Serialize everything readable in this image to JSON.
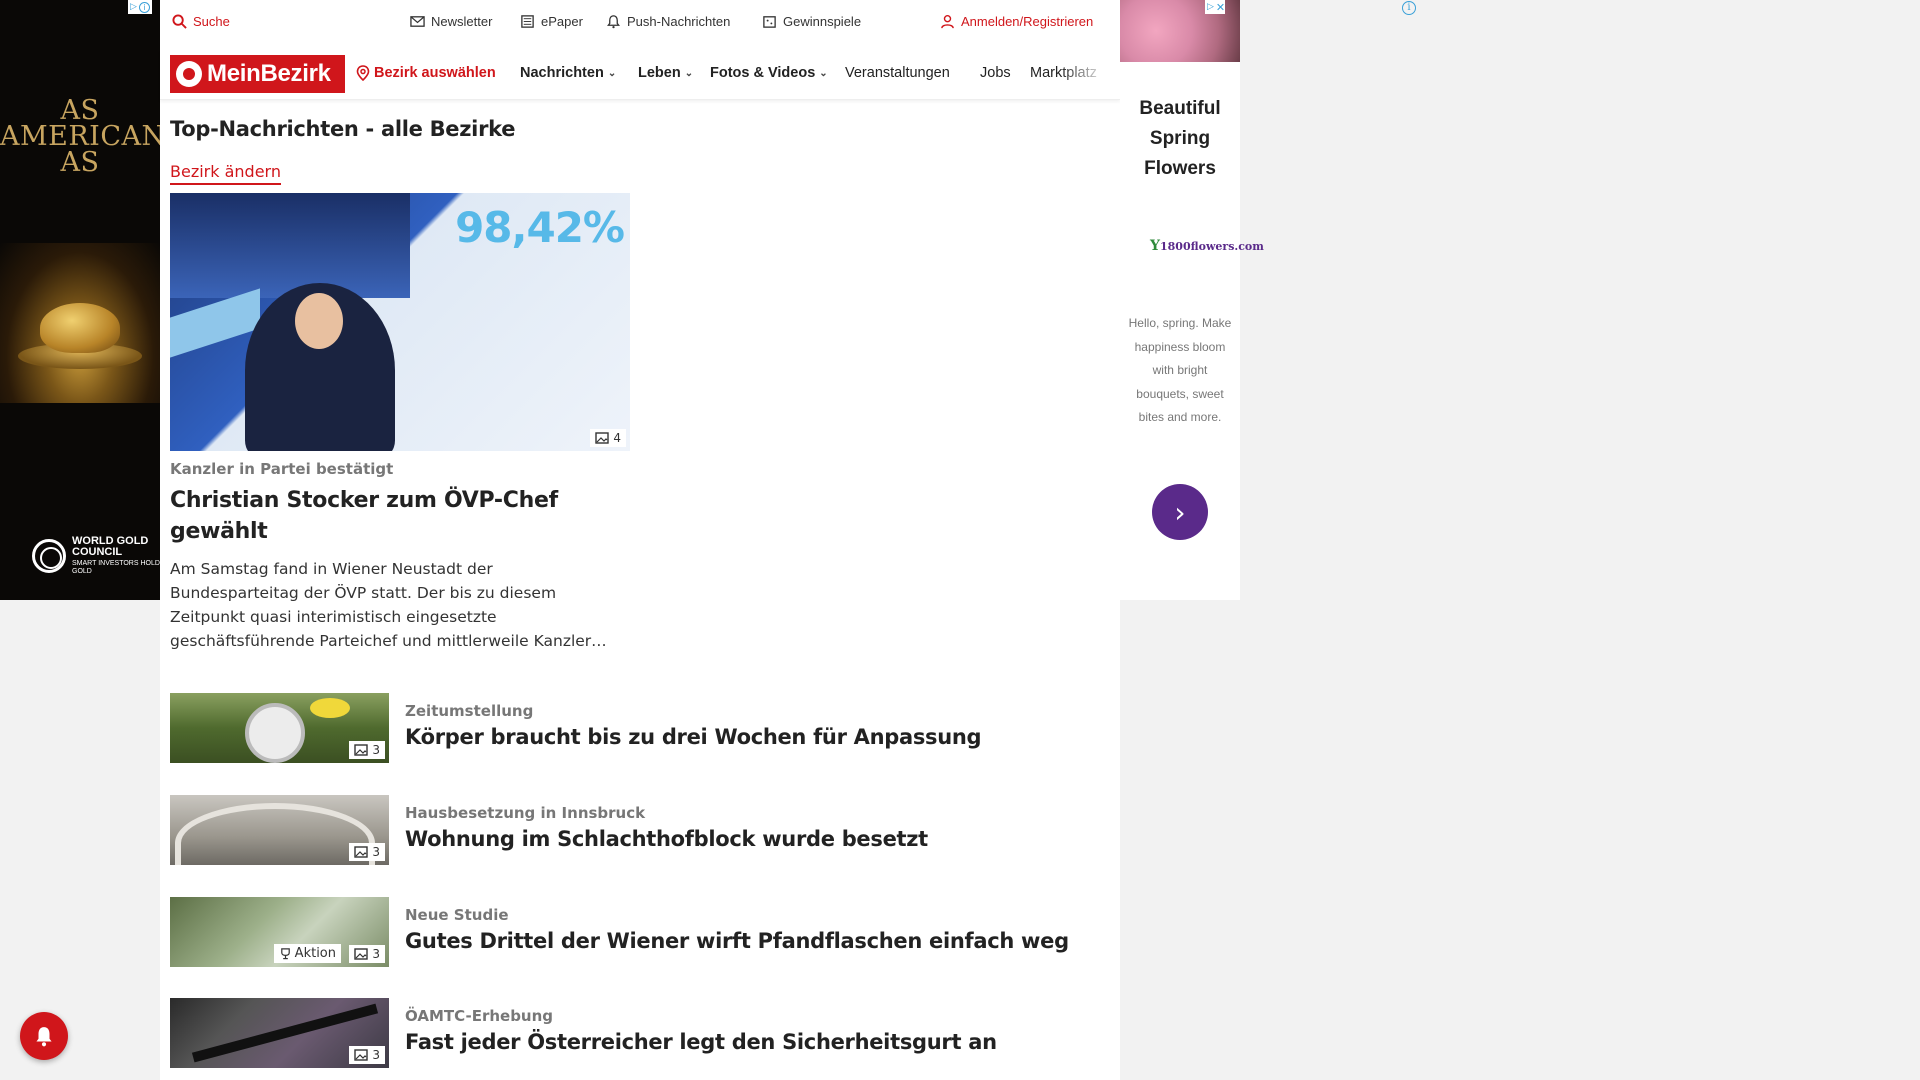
{
  "ads": {
    "left": {
      "headline": "AS AMERICAN AS",
      "logo_text": "WORLD GOLD COUNCIL",
      "logo_tagline": "SMART INVESTORS HOLD GOLD"
    },
    "right": {
      "title": "Beautiful Spring Flowers",
      "brand": "1800flowers.com",
      "body": "Hello, spring. Make happiness bloom with bright bouquets, sweet bites and more.",
      "cta_icon": "chevron-right-icon"
    }
  },
  "topbar": {
    "search": "Suche",
    "newsletter": "Newsletter",
    "epaper": "ePaper",
    "push": "Push-Nachrichten",
    "contests": "Gewinnspiele",
    "login": "Anmelden/Registrieren"
  },
  "nav": {
    "logo": "MeinBezirk",
    "district_select": "Bezirk auswählen",
    "items": [
      "Nachrichten",
      "Leben",
      "Fotos & Videos",
      "Veranstaltungen",
      "Jobs",
      "Marktplatz"
    ]
  },
  "section": {
    "title": "Top-Nachrichten - alle Bezirke",
    "change_district": "Bezirk ändern"
  },
  "hero": {
    "image_text": "98,42%",
    "image_count": "4",
    "kicker": "Kanzler in Partei bestätigt",
    "title": "Christian Stocker zum ÖVP-Chef gewählt",
    "teaser": "Am Samstag fand in Wiener Neustadt der Bundesparteitag der ÖVP statt. Der bis zu diesem Zeitpunkt quasi interimistisch eingesetzte geschäftsführende Parteichef und mittlerweile Kanzler…"
  },
  "articles": [
    {
      "kicker": "Zeitumstellung",
      "title": "Körper braucht bis zu drei Wochen für Anpassung",
      "image_count": "3"
    },
    {
      "kicker": "Hausbesetzung in Innsbruck",
      "title": "Wohnung im Schlachthofblock wurde besetzt",
      "image_count": "3"
    },
    {
      "kicker": "Neue Studie",
      "title": "Gutes Drittel der Wiener wirft Pfandflaschen einfach weg",
      "image_count": "3",
      "promo": "Aktion"
    },
    {
      "kicker": "ÖAMTC-Erhebung",
      "title": "Fast jeder Österreicher legt den Sicherheitsgurt an",
      "image_count": "3"
    }
  ],
  "colors": {
    "brand_red": "#d0161b",
    "ad_purple": "#5a2a8a",
    "gold": "#c8a560"
  }
}
